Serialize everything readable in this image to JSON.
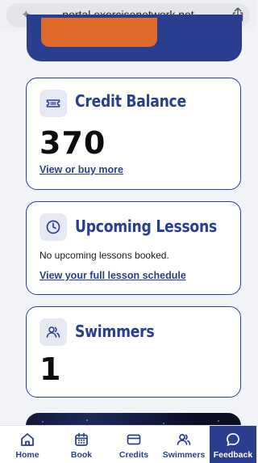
{
  "browser": {
    "url": "portal.exercisenetwork.net",
    "sparkle_icon": "sparkle-icon",
    "share_icon": "share-icon"
  },
  "hero": {
    "button_color": "#e06a2c"
  },
  "credit_card": {
    "icon": "ticket-icon",
    "title": "Credit Balance",
    "value": "370",
    "link": "View or buy more"
  },
  "lessons_card": {
    "icon": "clock-icon",
    "title": "Upcoming Lessons",
    "message": "No upcoming lessons booked.",
    "link": "View your full lesson schedule"
  },
  "swimmers_card": {
    "icon": "users-icon",
    "title": "Swimmers",
    "value": "1"
  },
  "nav": {
    "items": [
      {
        "label": "Home",
        "icon": "home-icon"
      },
      {
        "label": "Book",
        "icon": "calendar-icon"
      },
      {
        "label": "Credits",
        "icon": "card-icon"
      },
      {
        "label": "Swimmers",
        "icon": "users-icon"
      },
      {
        "label": "Feedback",
        "icon": "chat-bubble-icon"
      }
    ],
    "active": "Feedback"
  },
  "colors": {
    "brand_navy": "#2a3e90",
    "accent_orange": "#e06a2c",
    "background": "#f1f3f7"
  }
}
